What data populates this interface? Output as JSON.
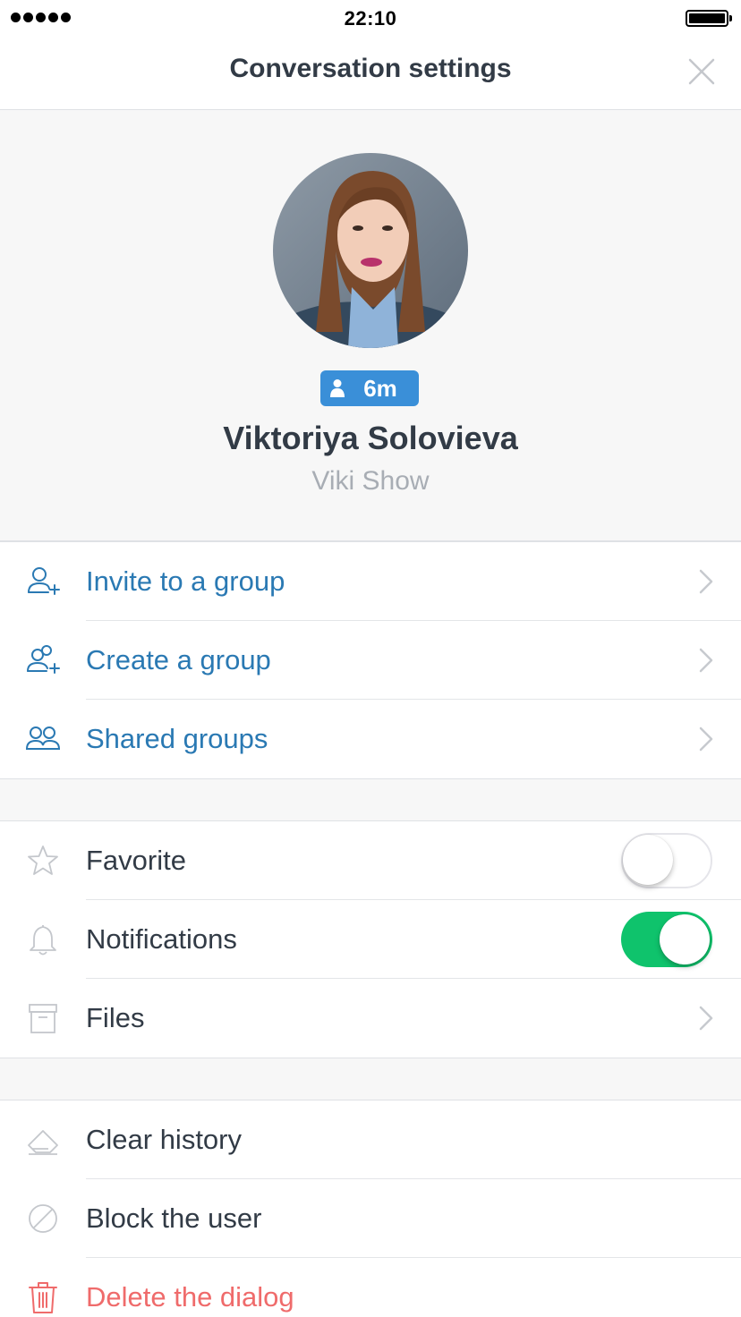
{
  "status_bar": {
    "time": "22:10"
  },
  "nav": {
    "title": "Conversation settings"
  },
  "profile": {
    "badge": "6m",
    "name": "Viktoriya Solovieva",
    "subtitle": "Viki Show"
  },
  "group_actions": [
    {
      "label": "Invite to a group",
      "icon": "person-add-icon"
    },
    {
      "label": "Create a group",
      "icon": "group-add-icon"
    },
    {
      "label": "Shared groups",
      "icon": "group-icon"
    }
  ],
  "preferences": {
    "favorite": {
      "label": "Favorite",
      "icon": "star-icon",
      "enabled": false
    },
    "notifications": {
      "label": "Notifications",
      "icon": "bell-icon",
      "enabled": true
    },
    "files": {
      "label": "Files",
      "icon": "archive-box-icon"
    }
  },
  "danger_actions": [
    {
      "label": "Clear history",
      "icon": "eraser-icon"
    },
    {
      "label": "Block the user",
      "icon": "block-icon"
    },
    {
      "label": "Delete the dialog",
      "icon": "trash-icon"
    }
  ],
  "colors": {
    "accent_blue": "#2a79b3",
    "badge_blue": "#3a8fd8",
    "toggle_on": "#0fc36c",
    "danger_red": "#ef6b6b"
  }
}
